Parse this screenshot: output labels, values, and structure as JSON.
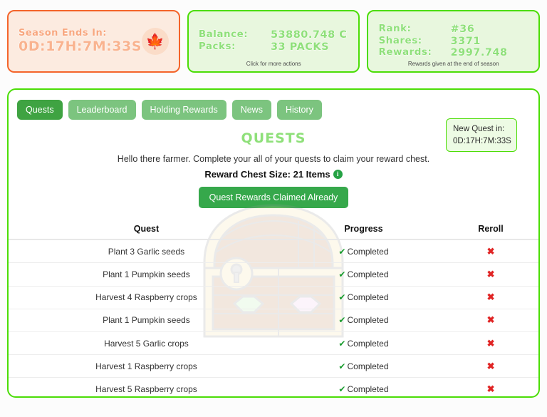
{
  "season_card": {
    "label": "Season Ends In:",
    "timer": "0D:17H:7M:33S",
    "icon": "maple-leaf-icon",
    "icon_glyph": "🍁",
    "border_color": "#f4642a",
    "bg_color": "#fcebe0"
  },
  "balance_card": {
    "rows": [
      {
        "key": "Balance:",
        "value": "53880.748 C"
      },
      {
        "key": "Packs:",
        "value": "33 PACKS"
      }
    ],
    "note": "Click for more actions",
    "border_color": "#4bdd06",
    "bg_color": "#e8f7de"
  },
  "rank_card": {
    "rows": [
      {
        "key": "Rank:",
        "value": "#36"
      },
      {
        "key": "Shares:",
        "value": "3371"
      },
      {
        "key": "Rewards:",
        "value": "2997.748"
      }
    ],
    "note": "Rewards given at the end of season",
    "border_color": "#4bdd06",
    "bg_color": "#e8f7de"
  },
  "tabs": [
    {
      "label": "Quests",
      "active": true
    },
    {
      "label": "Leaderboard",
      "active": false
    },
    {
      "label": "Holding Rewards",
      "active": false
    },
    {
      "label": "News",
      "active": false
    },
    {
      "label": "History",
      "active": false
    }
  ],
  "new_quest": {
    "label": "New Quest in:",
    "timer": "0D:17H:7M:33S"
  },
  "quests_panel": {
    "title": "QUESTS",
    "subtitle": "Hello there farmer. Complete your all of your quests to claim your reward chest.",
    "chest_size": "Reward Chest Size: 21 Items",
    "info_icon": "info-icon",
    "claim_button": "Quest Rewards Claimed Already",
    "accent_color": "#4bdd06",
    "active_tab_color": "#3fa342",
    "inactive_tab_color": "#7cc47f"
  },
  "table": {
    "headers": [
      "Quest",
      "Progress",
      "Reroll"
    ],
    "rows": [
      {
        "quest": "Plant 3 Garlic seeds",
        "progress": "Completed",
        "reroll": "✖"
      },
      {
        "quest": "Plant 1 Pumpkin seeds",
        "progress": "Completed",
        "reroll": "✖"
      },
      {
        "quest": "Harvest 4 Raspberry crops",
        "progress": "Completed",
        "reroll": "✖"
      },
      {
        "quest": "Plant 1 Pumpkin seeds",
        "progress": "Completed",
        "reroll": "✖"
      },
      {
        "quest": "Harvest 5 Garlic crops",
        "progress": "Completed",
        "reroll": "✖"
      },
      {
        "quest": "Harvest 1 Raspberry crops",
        "progress": "Completed",
        "reroll": "✖"
      },
      {
        "quest": "Harvest 5 Raspberry crops",
        "progress": "Completed",
        "reroll": "✖"
      }
    ],
    "check_glyph": "✔",
    "check_color": "#1a9c2f",
    "reroll_color": "#e02424"
  },
  "watermark": {
    "name": "treasure-chest-watermark"
  }
}
